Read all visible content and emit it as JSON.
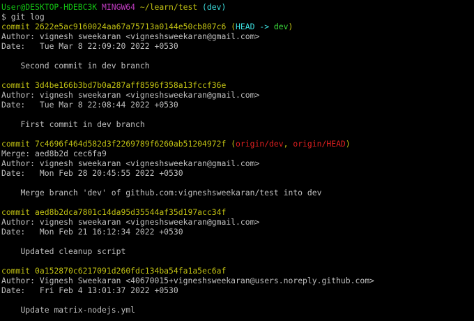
{
  "prompt": {
    "user_host": "User@DESKTOP-HDEBC3K",
    "shell": "MINGW64",
    "path": "~/learn/test",
    "branch": "(dev)",
    "symbol": "$",
    "command": "git log"
  },
  "colors": {
    "user_host": "#13c113",
    "shell": "#c13cc1",
    "path": "#c1c113",
    "branch": "#3ce0e0",
    "commit": "#c1c113",
    "head": "#3ce0e0",
    "local_branch": "#3cdc3c",
    "remote_branch": "#e02020",
    "text": "#c0c0c0",
    "background": "#000000"
  },
  "commits": [
    {
      "label": "commit",
      "hash": "2622e5ac9160024aa67a75713a0144e50cb807c6",
      "ref_open": "(",
      "ref_head": "HEAD -> ",
      "ref_branch": "dev",
      "ref_close": ")",
      "author_label": "Author:",
      "author": "vignesh sweekaran <vigneshsweekaran@gmail.com>",
      "date_label": "Date:",
      "date": "Tue Mar 8 22:09:20 2022 +0530",
      "message": "Second commit in dev branch"
    },
    {
      "label": "commit",
      "hash": "3d4be166b3bd7b0a287aff8596f358a13fccf36e",
      "author_label": "Author:",
      "author": "vignesh sweekaran <vigneshsweekaran@gmail.com>",
      "date_label": "Date:",
      "date": "Tue Mar 8 22:08:44 2022 +0530",
      "message": "First commit in dev branch"
    },
    {
      "label": "commit",
      "hash": "7c4696f464d582d3f2269789f6260ab51204972f",
      "ref_open": "(",
      "ref_remote1": "origin/dev",
      "ref_sep": ", ",
      "ref_remote2": "origin/HEAD",
      "ref_close": ")",
      "merge_label": "Merge:",
      "merge": "aed8b2d cec6fa9",
      "author_label": "Author:",
      "author": "vignesh sweekaran <vigneshsweekaran@gmail.com>",
      "date_label": "Date:",
      "date": "Mon Feb 28 20:45:55 2022 +0530",
      "message": "Merge branch 'dev' of github.com:vigneshsweekaran/test into dev"
    },
    {
      "label": "commit",
      "hash": "aed8b2dca7801c14da95d35544af35d197acc34f",
      "author_label": "Author:",
      "author": "vignesh sweekaran <vigneshsweekaran@gmail.com>",
      "date_label": "Date:",
      "date": "Mon Feb 21 16:12:34 2022 +0530",
      "message": "Updated cleanup script"
    },
    {
      "label": "commit",
      "hash": "0a152870c6217091d260fdc134ba54fa1a5ec6af",
      "author_label": "Author:",
      "author": "Vignesh Sweekaran <40670015+vigneshsweekaran@users.noreply.github.com>",
      "date_label": "Date:",
      "date": "Fri Feb 4 13:01:37 2022 +0530",
      "message": "Update matrix-nodejs.yml"
    }
  ]
}
